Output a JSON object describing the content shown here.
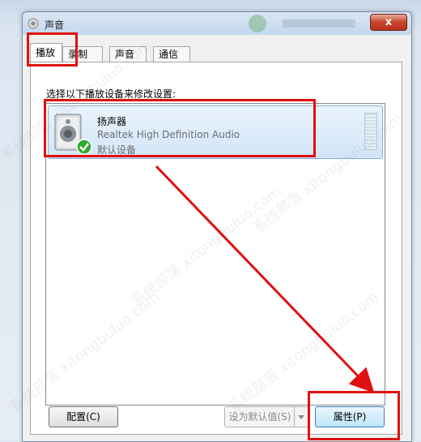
{
  "window": {
    "title": "声音",
    "close_label": "x"
  },
  "tabs": [
    {
      "label": "播放"
    },
    {
      "label": "录制"
    },
    {
      "label": "声音"
    },
    {
      "label": "通信"
    }
  ],
  "instruction": "选择以下播放设备来修改设置:",
  "devices": [
    {
      "name": "扬声器",
      "description": "Realtek High Definition Audio",
      "status": "默认设备",
      "icon": "speaker-icon",
      "status_icon": "green-check-icon"
    }
  ],
  "buttons": {
    "configure": "配置(C)",
    "set_default": "设为默认值(S)",
    "properties": "属性(P)"
  },
  "annotation_color": "#e01010",
  "watermark_text": "系统部落 xitongbuluo.com"
}
